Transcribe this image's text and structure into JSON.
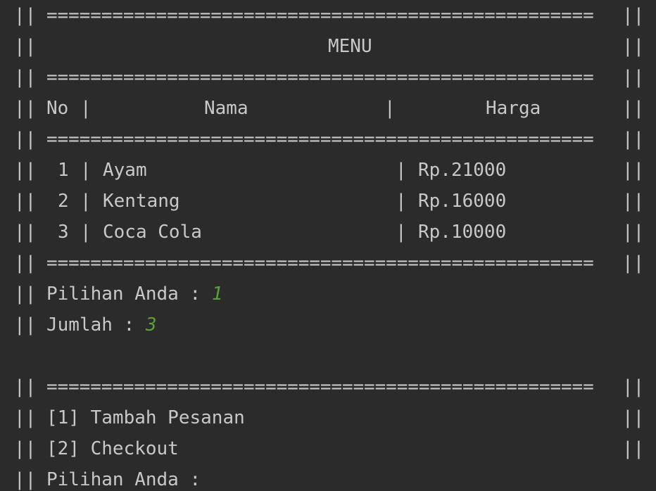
{
  "terminal": {
    "edge": "||",
    "rule": "==================================================",
    "title": "MENU",
    "header": {
      "no": "No",
      "pipe1": "|",
      "nama": "Nama",
      "pipe2": "|",
      "harga": "Harga"
    },
    "items": [
      {
        "no": "1",
        "pipe1": "|",
        "nama": "Ayam",
        "pipe2": "|",
        "harga": "Rp.21000"
      },
      {
        "no": "2",
        "pipe1": "|",
        "nama": "Kentang",
        "pipe2": "|",
        "harga": "Rp.16000"
      },
      {
        "no": "3",
        "pipe1": "|",
        "nama": "Coca Cola",
        "pipe2": "|",
        "harga": "Rp.10000"
      }
    ],
    "prompt_pilihan": "Pilihan Anda : ",
    "input_pilihan": "1",
    "prompt_jumlah": "Jumlah : ",
    "input_jumlah": "3",
    "option_1": "[1] Tambah Pesanan",
    "option_2": "[2] Checkout",
    "prompt_pilihan_2": "Pilihan Anda :"
  },
  "colors": {
    "background": "#2b2b2b",
    "text": "#c8c8c8",
    "user_input": "#5f9e3a"
  }
}
